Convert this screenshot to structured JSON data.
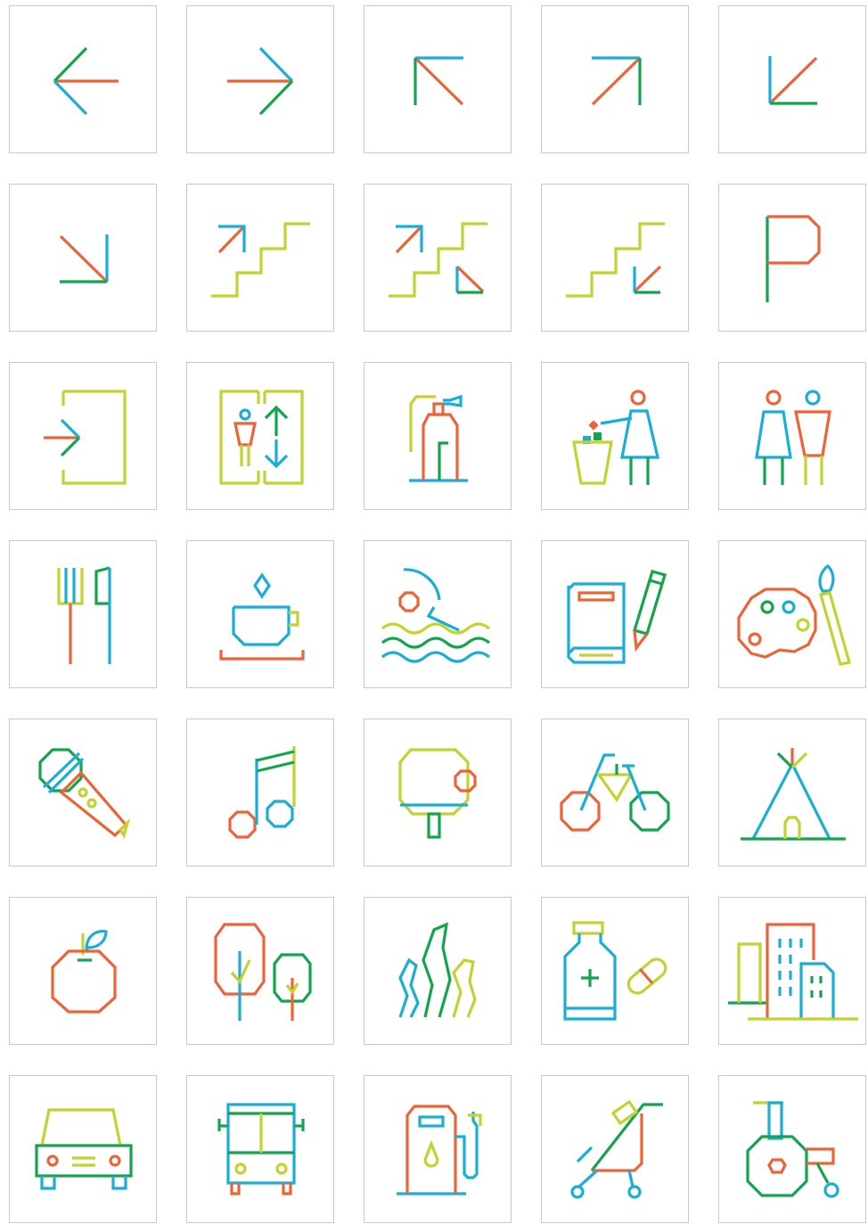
{
  "colors": {
    "orange": "#ef6236",
    "blue": "#19aed8",
    "green": "#12a54b",
    "lime": "#c2d22f",
    "tile_border": "#c9c9c9"
  },
  "icons": [
    "arrow-left-icon",
    "arrow-right-icon",
    "arrow-up-left-icon",
    "arrow-up-right-icon",
    "arrow-down-left-icon",
    "arrow-down-right-icon",
    "stairs-up-icon",
    "stairs-up-down-icon",
    "stairs-down-icon",
    "flag-icon",
    "entrance-icon",
    "elevator-icon",
    "fire-extinguisher-icon",
    "litter-bin-icon",
    "restroom-icon",
    "restaurant-icon",
    "cafe-icon",
    "swimming-icon",
    "book-pencil-icon",
    "art-palette-icon",
    "karaoke-microphone-icon",
    "music-note-icon",
    "table-tennis-icon",
    "bicycle-icon",
    "camping-tent-icon",
    "apple-icon",
    "trees-icon",
    "grass-icon",
    "pharmacy-icon",
    "city-buildings-icon",
    "car-icon",
    "bus-icon",
    "gas-station-icon",
    "stroller-icon",
    "tractor-icon"
  ]
}
